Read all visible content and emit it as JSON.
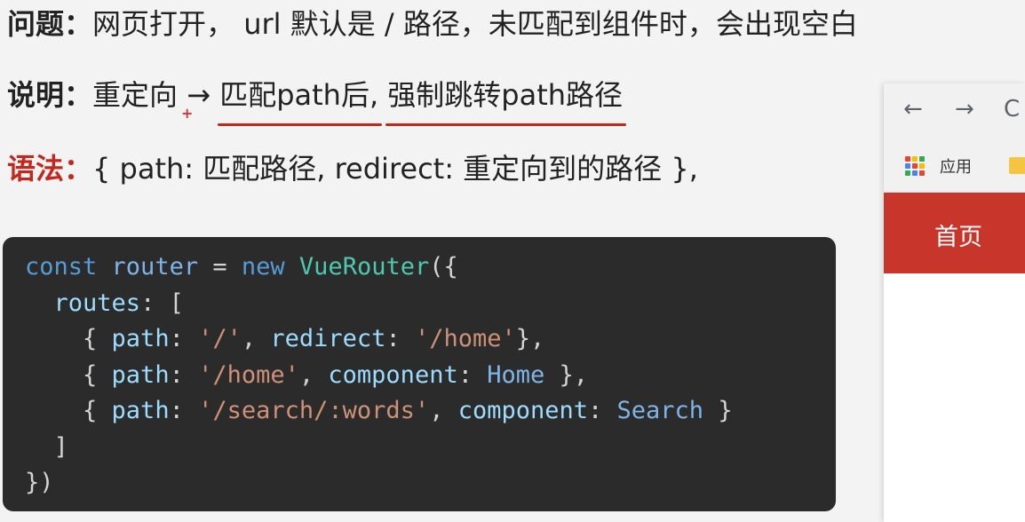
{
  "slide": {
    "problem_label": "问题：",
    "problem_text": "网页打开， url 默认是 / 路径，未匹配到组件时，会出现空白",
    "explain_label": "说明：",
    "explain_prefix": "重定向 → ",
    "explain_underlined_1": "匹配path后,",
    "explain_underlined_2": "强制跳转path路径",
    "plus_mark": "+",
    "syntax_label": "语法：",
    "syntax_text": "{ path: 匹配路径, redirect: 重定向到的路径 },"
  },
  "code": {
    "l1": [
      "const",
      " ",
      "router",
      " = ",
      "new",
      " ",
      "VueRouter",
      "({"
    ],
    "l2": [
      "  ",
      "routes",
      ": ["
    ],
    "l3": [
      "    { ",
      "path",
      ": ",
      "'/'",
      ", ",
      "redirect",
      ": ",
      "'/home'",
      "},"
    ],
    "l4": [
      "    { ",
      "path",
      ": ",
      "'/home'",
      ", ",
      "component",
      ": ",
      "Home",
      " },"
    ],
    "l5": [
      "    { ",
      "path",
      ": ",
      "'/search/:words'",
      ", ",
      "component",
      ": ",
      "Search",
      " }"
    ],
    "l6": [
      "  ]"
    ],
    "l7": [
      "})"
    ]
  },
  "browser": {
    "back": "←",
    "forward": "→",
    "reload": "C",
    "apps_label": "应用",
    "home_tab": "首页",
    "accent": "#c8352a",
    "apps_colors": [
      "#ea4335",
      "#fbbc05",
      "#34a853",
      "#4285f4",
      "#ea4335",
      "#fbbc05",
      "#34a853",
      "#4285f4",
      "#ea4335"
    ]
  }
}
